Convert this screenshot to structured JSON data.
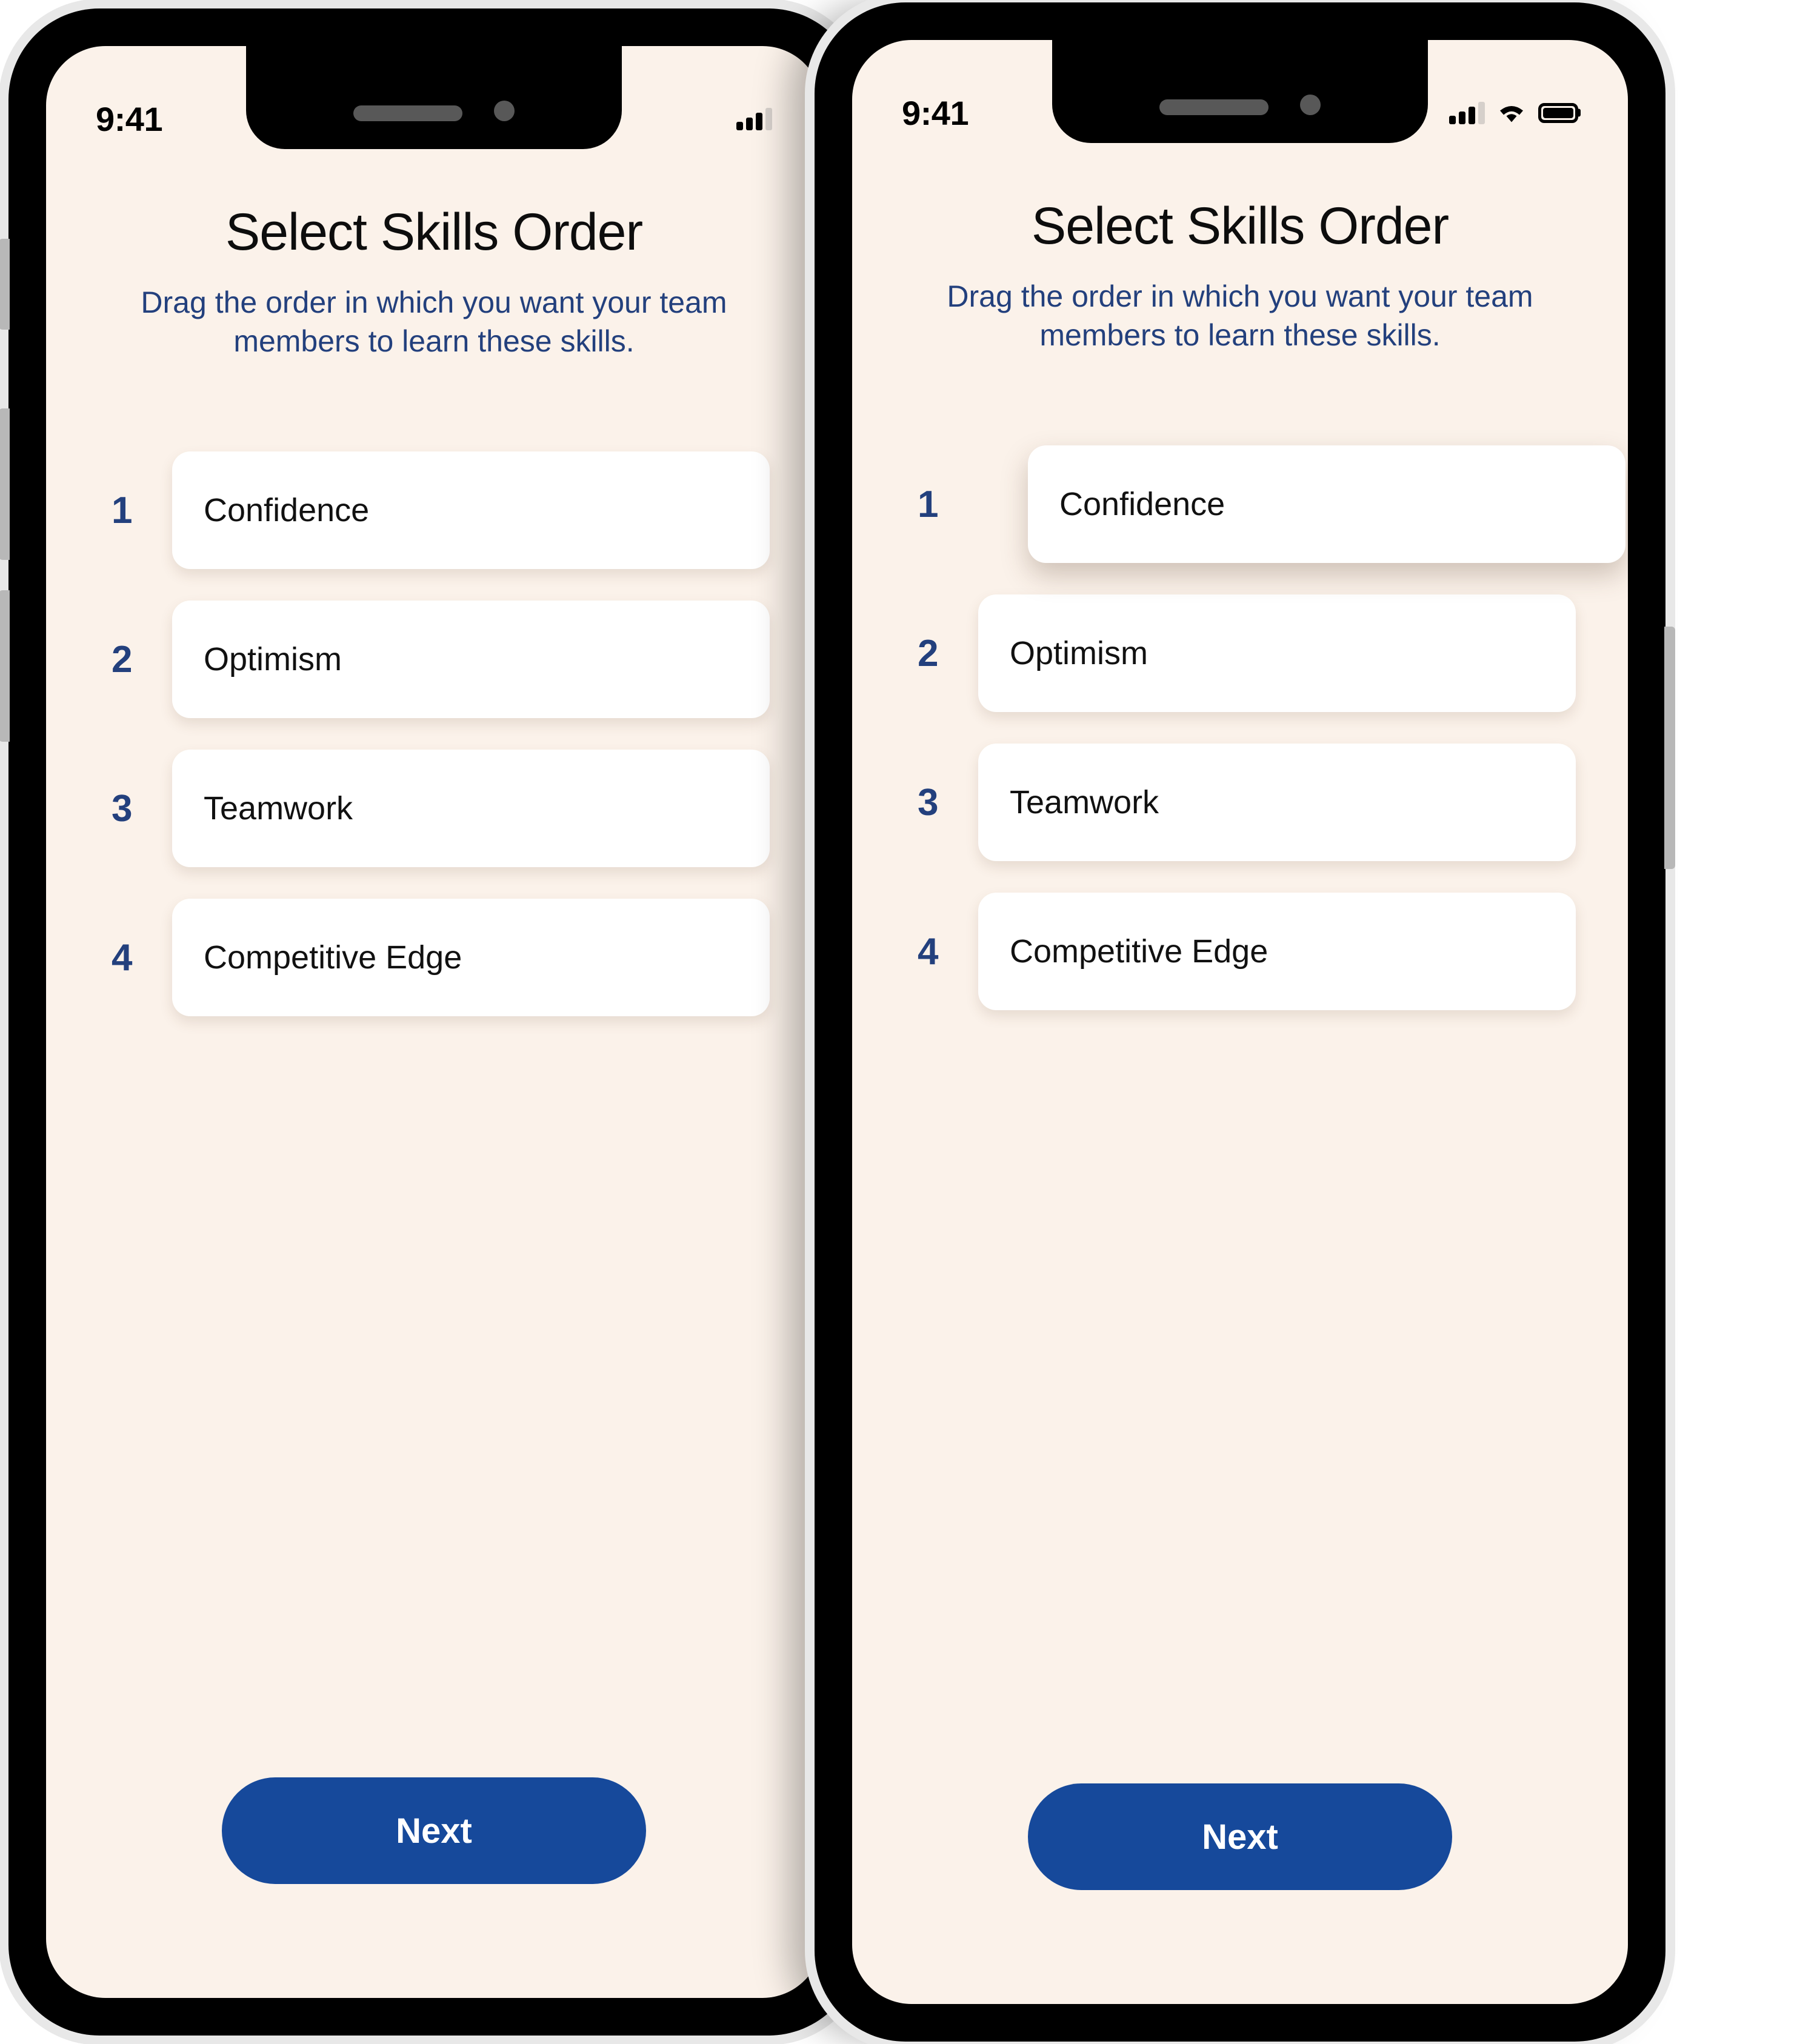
{
  "theme": {
    "screen_background": "#fbf2ea",
    "accent_blue": "#16499b",
    "text_navy": "#23407d",
    "card_white": "#ffffff",
    "frame_black": "#000000",
    "frame_edge_gray": "#e8e8e8"
  },
  "phones": [
    {
      "id": "left",
      "status_bar": {
        "time": "9:41",
        "icons": [
          "cellular-signal-icon"
        ]
      },
      "screen": {
        "title": "Select Skills Order",
        "subtitle": "Drag the order in which you want your team members to learn these skills.",
        "skills": [
          {
            "index": "1",
            "label": "Confidence",
            "dragging": false
          },
          {
            "index": "2",
            "label": "Optimism",
            "dragging": false
          },
          {
            "index": "3",
            "label": "Teamwork",
            "dragging": false
          },
          {
            "index": "4",
            "label": "Competitive Edge",
            "dragging": false
          }
        ],
        "primary_button": "Next"
      }
    },
    {
      "id": "right",
      "status_bar": {
        "time": "9:41",
        "icons": [
          "cellular-signal-icon",
          "wifi-icon",
          "battery-full-icon"
        ]
      },
      "screen": {
        "title": "Select Skills Order",
        "subtitle": "Drag the order in which you want your team members to learn these skills.",
        "skills": [
          {
            "index": "1",
            "label": "Confidence",
            "dragging": true
          },
          {
            "index": "2",
            "label": "Optimism",
            "dragging": false
          },
          {
            "index": "3",
            "label": "Teamwork",
            "dragging": false
          },
          {
            "index": "4",
            "label": "Competitive Edge",
            "dragging": false
          }
        ],
        "primary_button": "Next"
      }
    }
  ]
}
